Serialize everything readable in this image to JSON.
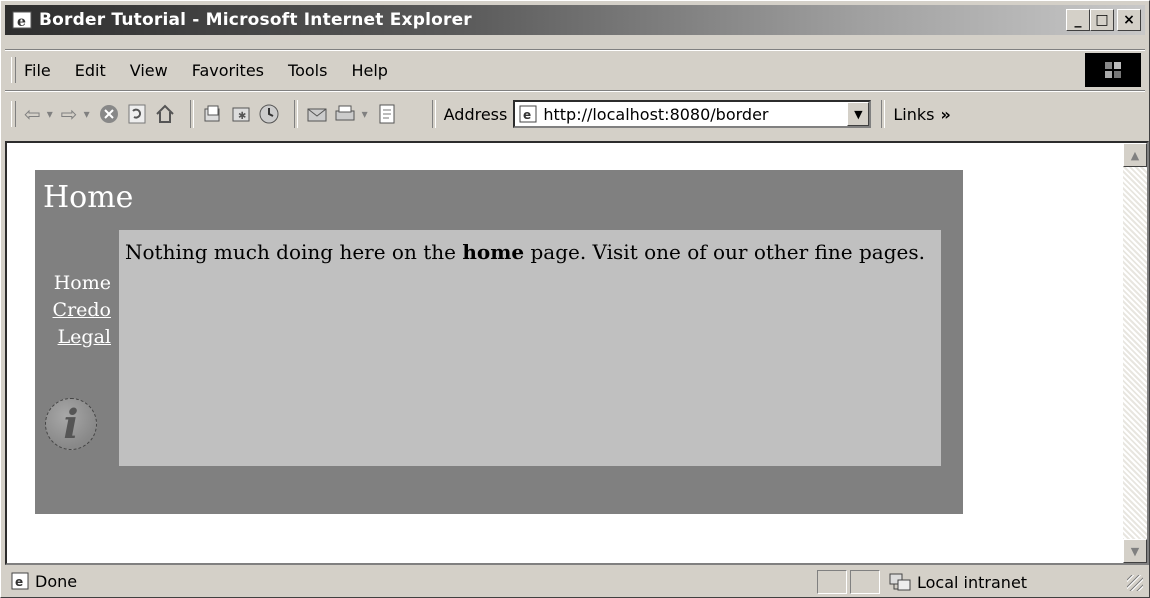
{
  "window": {
    "title": "Border Tutorial - Microsoft Internet Explorer",
    "controls": {
      "minimize": "_",
      "maximize": "□",
      "close": "×"
    }
  },
  "menu": [
    {
      "label": "File"
    },
    {
      "label": "Edit"
    },
    {
      "label": "View"
    },
    {
      "label": "Favorites"
    },
    {
      "label": "Tools"
    },
    {
      "label": "Help"
    }
  ],
  "toolbar": {
    "address_label": "Address",
    "address_value": "http://localhost:8080/border",
    "links_label": "Links",
    "links_chevron": "»",
    "icons": [
      "back-icon",
      "forward-icon",
      "stop-icon",
      "refresh-icon",
      "home-icon",
      "search-icon",
      "favorites-icon",
      "history-icon",
      "print-icon",
      "edit-icon",
      "discuss-icon"
    ]
  },
  "page": {
    "heading": "Home",
    "nav_current": "Home",
    "nav_links": [
      "Credo",
      "Legal"
    ],
    "body_before": "Nothing much doing here on the ",
    "body_bold": "home",
    "body_after": " page. Visit one of our other fine pages.",
    "info_glyph": "i",
    "colors": {
      "outer": "#808080",
      "inner": "#c0c0c0",
      "text_light": "#ffffff"
    }
  },
  "status": {
    "text": "Done",
    "zone": "Local intranet"
  }
}
